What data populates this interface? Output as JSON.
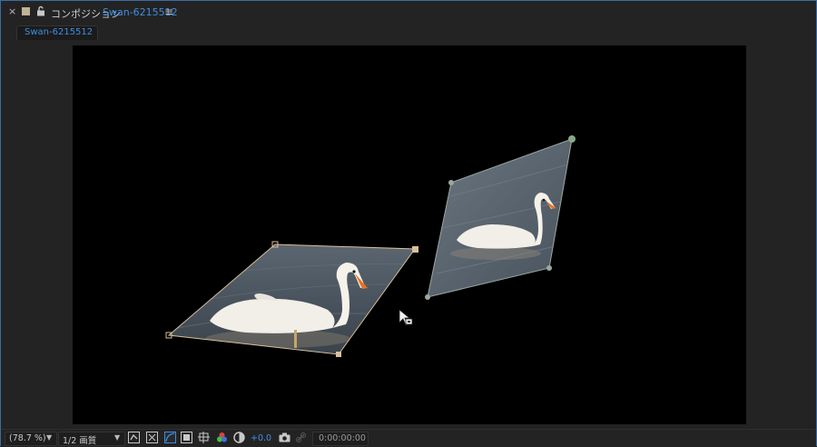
{
  "panel": {
    "close_glyph": "×",
    "label_color": "#c2b395",
    "panel_label": "コンポジション",
    "composition_name": "Swan-6215512",
    "menu_glyph": "≡"
  },
  "tab": {
    "label": "Swan-6215512"
  },
  "status_bar": {
    "zoom_value": "(78.7 %)",
    "quality_value": "1/2 画質",
    "exposure_value": "+0.0",
    "timecode": "0:00:00:00"
  },
  "colors": {
    "accent_blue": "#3d8fe0",
    "layer_handle_selected": "#d8c09a",
    "layer_handle_other": "#9aa8a0",
    "canvas": "#000000"
  },
  "icons": [
    "close-icon",
    "label-color-swatch",
    "lock-icon",
    "panel-menu-icon",
    "chevron-down-icon",
    "toggle-transparency-grid-icon",
    "region-of-interest-icon",
    "toggle-mask-path-icon",
    "safe-margins-icon",
    "grid-guides-icon",
    "color-channels-icon",
    "exposure-reset-icon",
    "snapshot-camera-icon",
    "show-snapshot-icon",
    "move-cursor-icon"
  ]
}
